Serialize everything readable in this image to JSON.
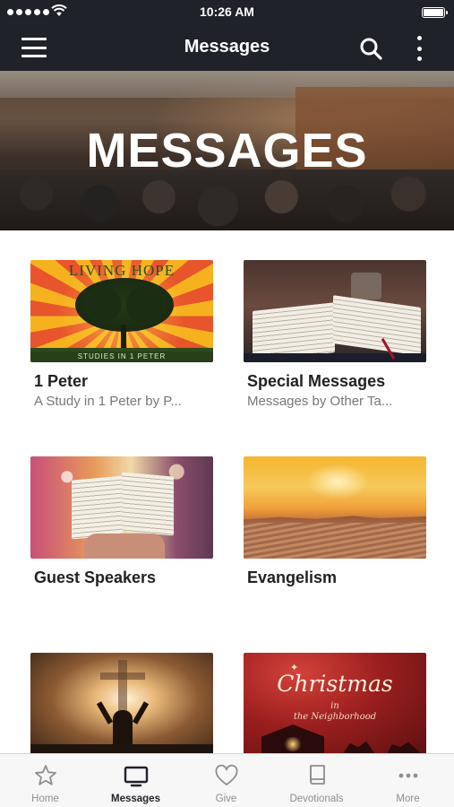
{
  "status_bar": {
    "time": "10:26 AM"
  },
  "nav": {
    "title": "Messages"
  },
  "hero": {
    "title": "MESSAGES"
  },
  "cards": [
    {
      "title": "1 Peter",
      "subtitle": "A Study in 1 Peter by P...",
      "image_text": {
        "headline": "LIVING HOPE",
        "band": "STUDIES IN 1 PETER"
      }
    },
    {
      "title": "Special Messages",
      "subtitle": "Messages by Other Ta..."
    },
    {
      "title": "Guest Speakers",
      "subtitle": ""
    },
    {
      "title": "Evangelism",
      "subtitle": ""
    },
    {
      "title": "",
      "subtitle": ""
    },
    {
      "title": "",
      "subtitle": "",
      "image_text": {
        "headline": "Christmas",
        "line1": "in",
        "line2": "the Neighborhood"
      }
    }
  ],
  "tabs": [
    {
      "label": "Home",
      "icon": "star-icon",
      "active": false
    },
    {
      "label": "Messages",
      "icon": "tv-icon",
      "active": true
    },
    {
      "label": "Give",
      "icon": "heart-icon",
      "active": false
    },
    {
      "label": "Devotionals",
      "icon": "book-icon",
      "active": false
    },
    {
      "label": "More",
      "icon": "more-horiz-icon",
      "active": false
    }
  ],
  "colors": {
    "bar_dark": "#1f2228",
    "tab_inactive": "#8e8e93",
    "tab_active": "#1f2228"
  }
}
